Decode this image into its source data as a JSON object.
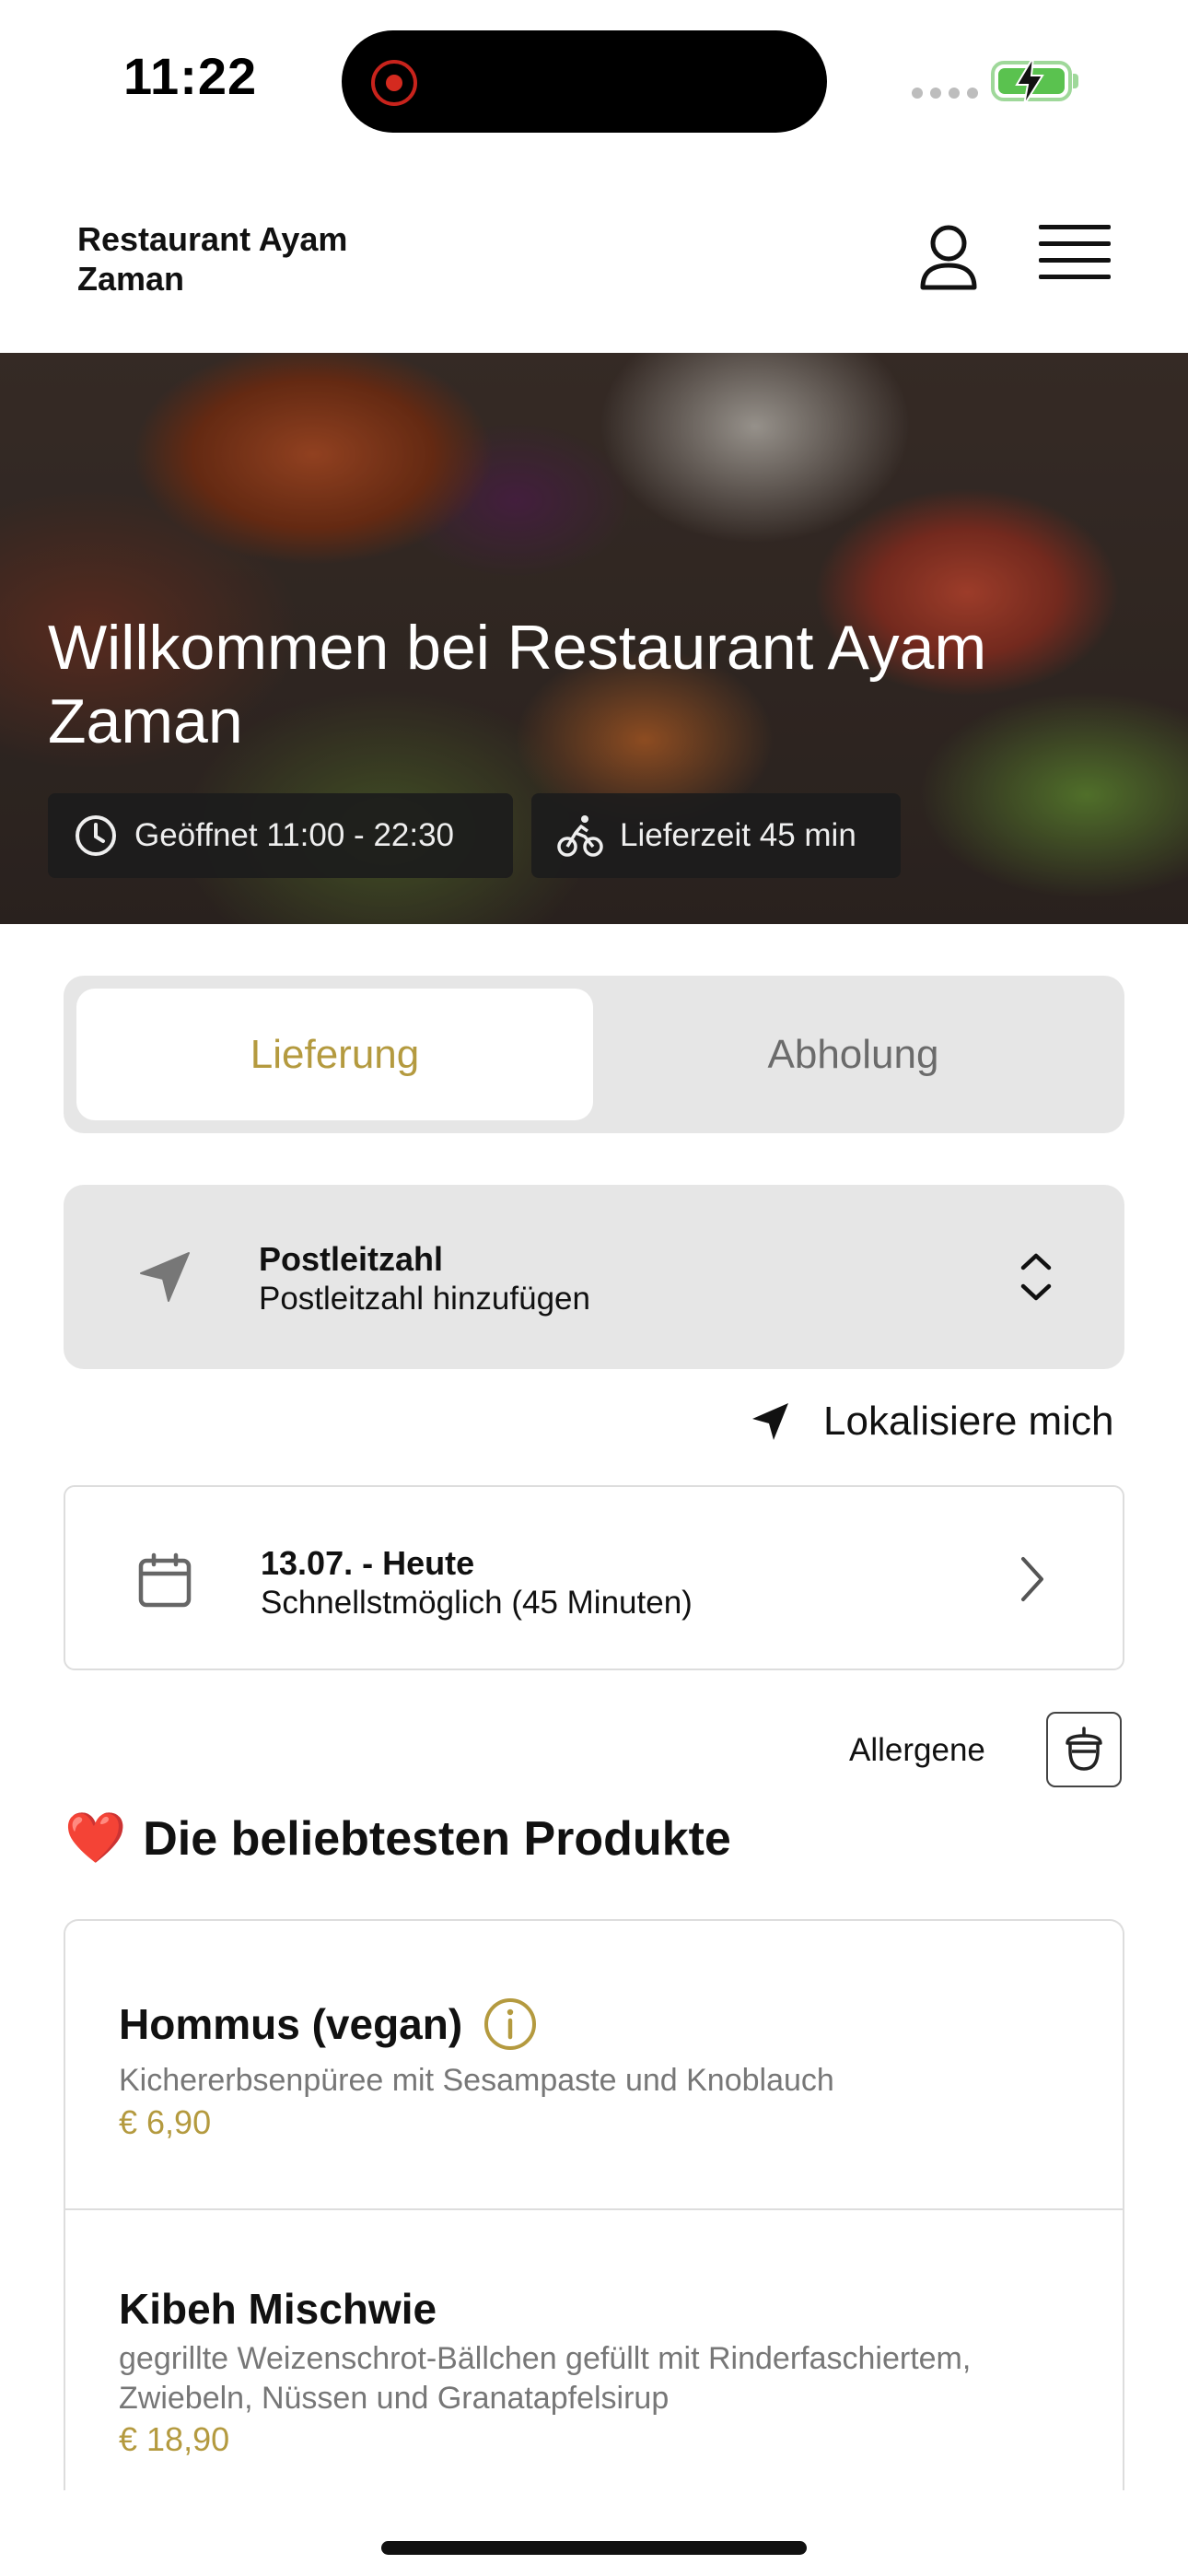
{
  "status_bar": {
    "time": "11:22"
  },
  "header": {
    "brand": "Restaurant Ayam Zaman"
  },
  "hero": {
    "title": "Willkommen bei Restaurant Ayam Zaman",
    "opening_hours": "Geöffnet 11:00 - 22:30",
    "delivery_time": "Lieferzeit 45 min"
  },
  "tabs": [
    {
      "label": "Lieferung",
      "active": true
    },
    {
      "label": "Abholung",
      "active": false
    }
  ],
  "postal": {
    "label": "Postleitzahl",
    "placeholder": "Postleitzahl hinzufügen"
  },
  "locate": {
    "label": "Lokalisiere mich"
  },
  "date": {
    "label": "13.07. - Heute",
    "value": "Schnellstmöglich (45 Minuten)"
  },
  "allergens": {
    "label": "Allergene"
  },
  "section": {
    "title": "Die beliebtesten Produkte",
    "emoji": "❤️"
  },
  "products": [
    {
      "name": "Hommus (vegan)",
      "description": "Kichererbsenpüree mit Sesampaste und Knoblauch",
      "price": "€ 6,90",
      "has_info": true
    },
    {
      "name": "Kibeh Mischwie",
      "description": "gegrillte Weizenschrot-Bällchen gefüllt mit Rinderfaschiertem, Zwiebeln, Nüssen und Granatapfelsirup",
      "price": "€ 18,90",
      "has_info": false
    }
  ],
  "colors": {
    "accent": "#b49a3f",
    "panel": "#e6e6e6",
    "border": "#dddddd",
    "battery": "#5ac24f"
  },
  "icons": [
    "record-icon",
    "battery-icon",
    "user-icon",
    "hamburger-menu-icon",
    "clock-icon",
    "bicycle-icon",
    "navigation-arrow-icon",
    "chevron-up-down-icon",
    "location-arrow-icon",
    "calendar-icon",
    "chevron-right-icon",
    "acorn-allergen-icon",
    "heart-icon",
    "info-icon"
  ]
}
